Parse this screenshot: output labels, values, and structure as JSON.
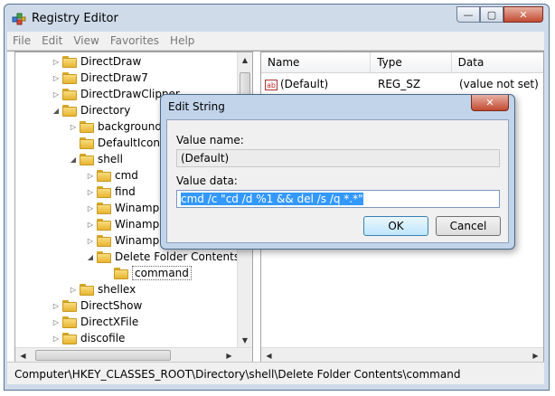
{
  "window": {
    "title": "Registry Editor"
  },
  "caption_buttons": {
    "minimize": "—",
    "maximize": "▢",
    "close": "✕"
  },
  "menu": [
    "File",
    "Edit",
    "View",
    "Favorites",
    "Help"
  ],
  "tree": [
    {
      "label": "DirectDraw",
      "indent": 0,
      "expander": "▷",
      "selected": false
    },
    {
      "label": "DirectDraw7",
      "indent": 0,
      "expander": "▷",
      "selected": false
    },
    {
      "label": "DirectDrawClipper",
      "indent": 0,
      "expander": "▷",
      "selected": false
    },
    {
      "label": "Directory",
      "indent": 0,
      "expander": "◢",
      "selected": false
    },
    {
      "label": "background",
      "indent": 1,
      "expander": "▷",
      "selected": false
    },
    {
      "label": "DefaultIcon",
      "indent": 1,
      "expander": "",
      "selected": false
    },
    {
      "label": "shell",
      "indent": 1,
      "expander": "◢",
      "selected": false
    },
    {
      "label": "cmd",
      "indent": 2,
      "expander": "▷",
      "selected": false
    },
    {
      "label": "find",
      "indent": 2,
      "expander": "▷",
      "selected": false
    },
    {
      "label": "Winamp.",
      "indent": 2,
      "expander": "▷",
      "selected": false
    },
    {
      "label": "Winamp.",
      "indent": 2,
      "expander": "▷",
      "selected": false
    },
    {
      "label": "Winamp.",
      "indent": 2,
      "expander": "▷",
      "selected": false
    },
    {
      "label": "Delete Folder Contents",
      "indent": 2,
      "expander": "◢",
      "selected": false
    },
    {
      "label": "command",
      "indent": 3,
      "expander": "",
      "selected": true
    },
    {
      "label": "shellex",
      "indent": 1,
      "expander": "▷",
      "selected": false
    },
    {
      "label": "DirectShow",
      "indent": 0,
      "expander": "▷",
      "selected": false
    },
    {
      "label": "DirectXFile",
      "indent": 0,
      "expander": "▷",
      "selected": false
    },
    {
      "label": "discofile",
      "indent": 0,
      "expander": "▷",
      "selected": false
    }
  ],
  "values_pane": {
    "columns": [
      "Name",
      "Type",
      "Data"
    ],
    "rows": [
      {
        "name": "(Default)",
        "type": "REG_SZ",
        "data": "(value not set)",
        "icon": "ab"
      }
    ]
  },
  "status": {
    "path": "Computer\\HKEY_CLASSES_ROOT\\Directory\\shell\\Delete Folder Contents\\command"
  },
  "dialog": {
    "title": "Edit String",
    "close": "✕",
    "value_name_label": "Value name:",
    "value_name": "(Default)",
    "value_data_label": "Value data:",
    "value_data": "cmd /c \"cd /d %1 && del /s /q *.*\"",
    "ok_label": "OK",
    "cancel_label": "Cancel"
  },
  "scroll_arrows": {
    "up": "▲",
    "down": "▼",
    "left": "◀",
    "right": "▶"
  }
}
